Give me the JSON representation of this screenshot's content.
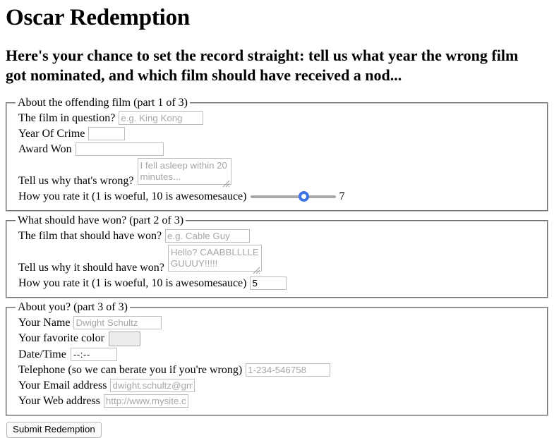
{
  "page": {
    "title": "Oscar Redemption",
    "subtitle": "Here's your chance to set the record straight: tell us what year the wrong film got nominated, and which film should have received a nod..."
  },
  "section1": {
    "legend": "About the offending film (part 1 of 3)",
    "film_label": "The film in question?",
    "film_placeholder": "e.g. King Kong",
    "film_value": "",
    "year_label": "Year Of Crime",
    "year_placeholder": "",
    "year_value": "",
    "award_label": "Award Won",
    "award_placeholder": "",
    "award_value": "",
    "why_label": "Tell us why that's wrong?",
    "why_placeholder": "I fell asleep within 20 minutes...",
    "why_value": "",
    "rate_label": "How you rate it (1 is woeful, 10 is awesomesauce)",
    "rate_value": "7",
    "rate_min": "1",
    "rate_max": "10"
  },
  "section2": {
    "legend": "What should have won? (part 2 of 3)",
    "film_label": "The film that should have won?",
    "film_placeholder": "e.g. Cable Guy",
    "film_value": "",
    "why_label": "Tell us why it should have won?",
    "why_placeholder": "Hello? CAABBLLLLE GUUUY!!!!!",
    "why_value": "",
    "rate_label": "How you rate it (1 is woeful, 10 is awesomesauce)",
    "rate_value": "5"
  },
  "section3": {
    "legend": "About you? (part 3 of 3)",
    "name_label": "Your Name",
    "name_placeholder": "Dwight Schultz",
    "name_value": "",
    "color_label": "Your favorite color",
    "color_value": "#000000",
    "datetime_label": "Date/Time",
    "datetime_value": "--:--",
    "telephone_label": "Telephone (so we can berate you if you're wrong)",
    "telephone_placeholder": "1-234-546758",
    "telephone_value": "",
    "email_label": "Your Email address",
    "email_placeholder": "dwight.schultz@gmail.com",
    "email_value": "",
    "web_label": "Your Web address",
    "web_placeholder": "http://www.mysite.com",
    "web_value": ""
  },
  "submit": {
    "label": "Submit Redemption"
  },
  "colors": {
    "slider_thumb": "#3f73e3",
    "slider_track": "#a8a8a8",
    "input_border": "#bdbdbd",
    "placeholder": "#a6a6a6",
    "fieldset_border": "#c0c0c0"
  }
}
